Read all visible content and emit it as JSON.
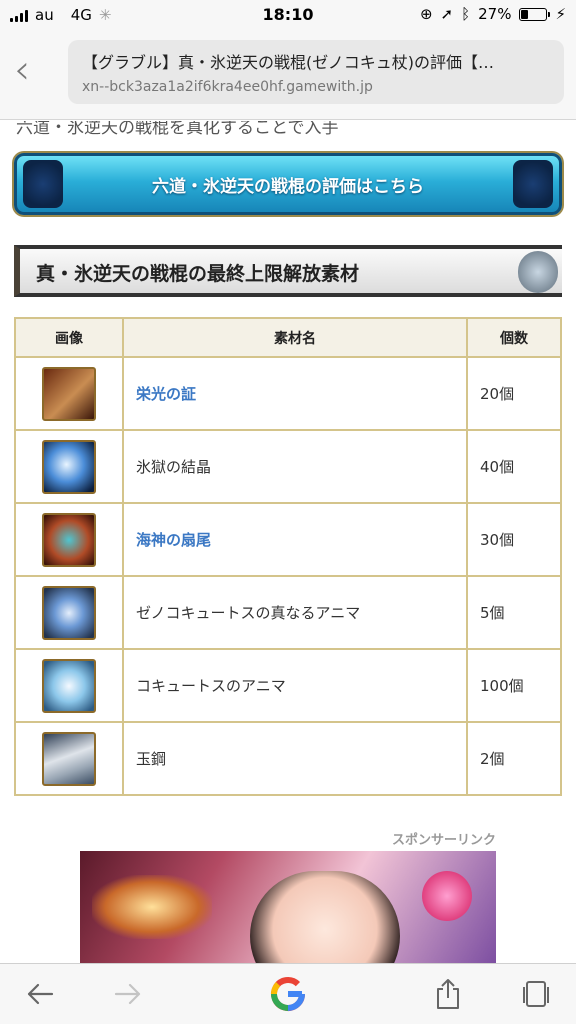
{
  "status_bar": {
    "carrier": "au",
    "network": "4G",
    "time": "18:10",
    "battery": "27%"
  },
  "address_bar": {
    "title": "【グラブル】真・氷逆天の戦棍(ゼノコキュ杖)の評価【…",
    "domain": "xn--bck3aza1a2if6kra4ee0hf.gamewith.jp"
  },
  "page": {
    "cut_text": "六道・氷逆天の戦棍を真化することで入手",
    "blue_button_label": "六道・氷逆天の戦棍の評価はこちら",
    "section_title": "真・氷逆天の戦棍の最終上限解放素材",
    "table": {
      "headers": [
        "画像",
        "素材名",
        "個数"
      ],
      "rows": [
        {
          "name": "栄光の証",
          "count": "20個",
          "link": true,
          "icon": "glory-proof-icon"
        },
        {
          "name": "氷獄の結晶",
          "count": "40個",
          "link": false,
          "icon": "ice-crystal-icon"
        },
        {
          "name": "海神の扇尾",
          "count": "30個",
          "link": true,
          "icon": "sea-god-tail-icon"
        },
        {
          "name": "ゼノコキュートスの真なるアニマ",
          "count": "5個",
          "link": false,
          "icon": "xeno-cocytus-true-anima-icon"
        },
        {
          "name": "コキュートスのアニマ",
          "count": "100個",
          "link": false,
          "icon": "cocytus-anima-icon"
        },
        {
          "name": "玉鋼",
          "count": "2個",
          "link": false,
          "icon": "tamahagane-icon"
        }
      ]
    },
    "sponsor_label": "スポンサーリンク"
  },
  "toolbar": {
    "icons": [
      "back-arrow-icon",
      "forward-arrow-icon",
      "google-icon",
      "share-icon",
      "tabs-icon"
    ]
  }
}
